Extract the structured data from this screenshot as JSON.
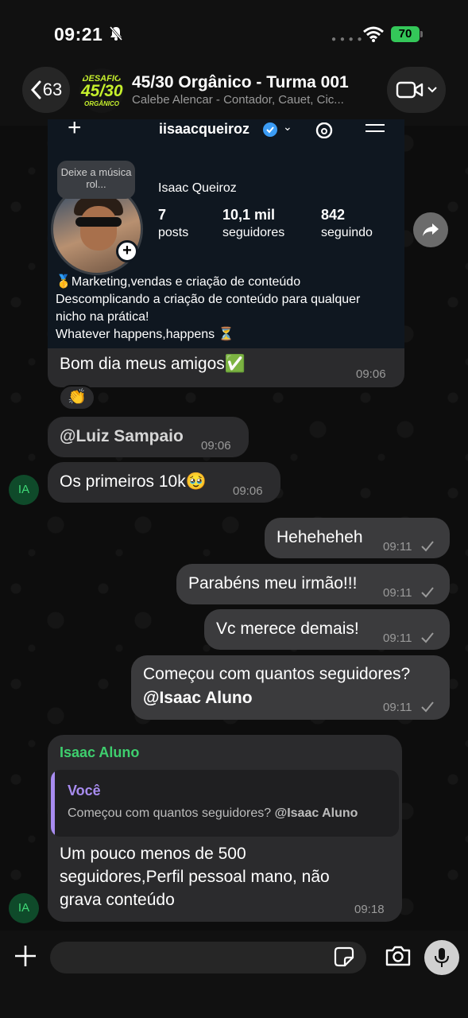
{
  "status_bar": {
    "time": "09:21",
    "battery": "70"
  },
  "header": {
    "back_count": "63",
    "avatar_text_top": "DESAFIO",
    "avatar_text_big": "45/30",
    "avatar_text_bottom": "ORGÂNICO",
    "title": "45/30 Orgânico - Turma 001",
    "members": "Calebe Alencar - Contador, Cauet, Cic..."
  },
  "instagram_card": {
    "username": "iisaacqueiroz",
    "note": "Deixe a música rol...",
    "name": "Isaac Queiroz",
    "posts_count": "7",
    "posts_label": "posts",
    "followers_count": "10,1 mil",
    "followers_label": "seguidores",
    "following_count": "842",
    "following_label": "seguindo",
    "bio_line1": "🥇Marketing,vendas e criação de conteúdo",
    "bio_line2": "Descomplicando a criação de conteúdo para qualquer",
    "bio_line3": "nicho na prática!",
    "bio_line4": "Whatever happens,happens ⏳",
    "caption": "Bom dia meus amigos✅",
    "time": "09:06",
    "reaction": "👏"
  },
  "messages": [
    {
      "text": "@Luiz Sampaio",
      "time": "09:06"
    },
    {
      "avatar": "IA",
      "text": "Os primeiros 10k🥹",
      "time": "09:06"
    },
    {
      "text": "Heheheheh",
      "time": "09:11"
    },
    {
      "text": "Parabéns meu irmão!!!",
      "time": "09:11"
    },
    {
      "text": "Vc merece demais!",
      "time": "09:11"
    },
    {
      "text": "Começou com quantos seguidores?",
      "mention": "@Isaac Aluno",
      "time": "09:11"
    },
    {
      "avatar": "IA",
      "sender": "Isaac Aluno",
      "quote_author": "Você",
      "quote_text": "Começou com quantos seguidores? ",
      "quote_mention": "@Isaac Aluno",
      "line1": "Um pouco menos de 500",
      "line2": "seguidores,Perfil pessoal mano, não",
      "line3": "grava conteúdo",
      "time": "09:18"
    }
  ],
  "input": {
    "placeholder": "",
    "value": ""
  },
  "colors": {
    "sender_name": "#3ecf6e",
    "quote_accent": "#a88cf0",
    "battery": "#34c759"
  }
}
